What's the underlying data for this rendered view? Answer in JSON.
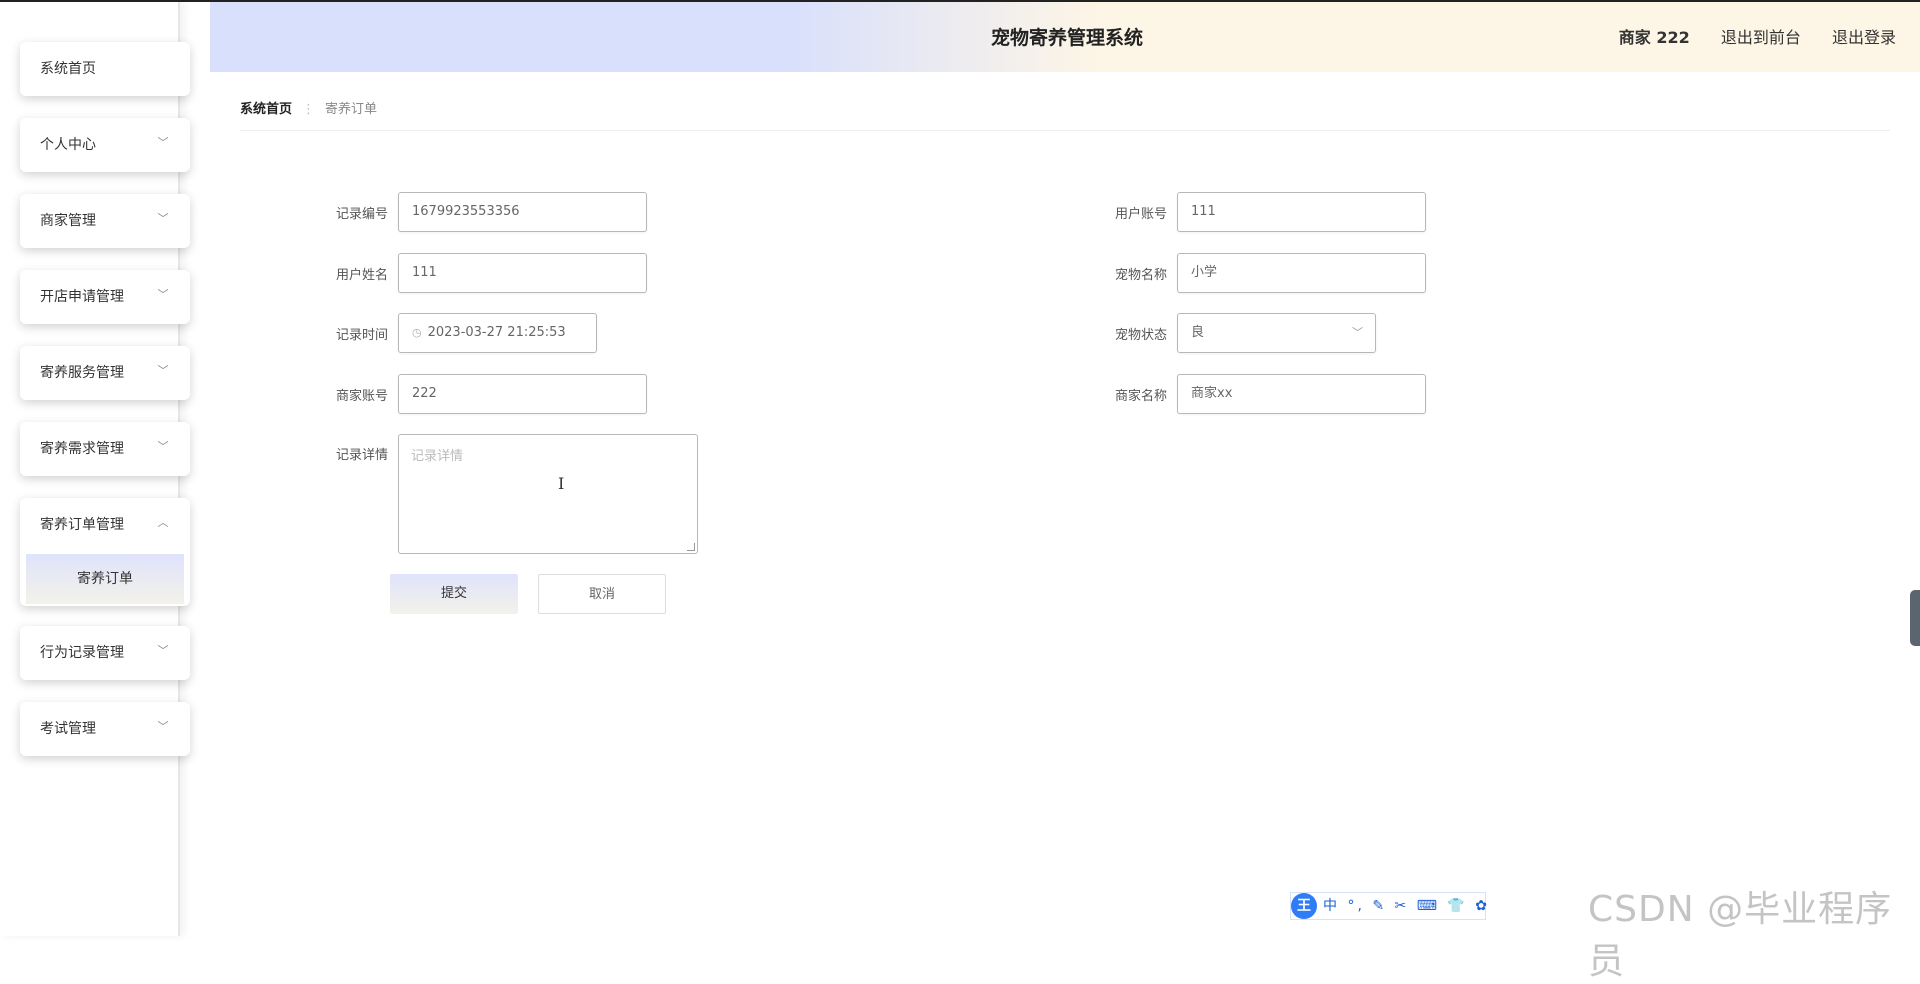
{
  "app_title": "宠物寄养管理系统",
  "header": {
    "merchant": "商家 222",
    "back_to_front": "退出到前台",
    "logout": "退出登录"
  },
  "sidebar": {
    "items": [
      {
        "label": "系统首页",
        "icon": "none"
      },
      {
        "label": "个人中心",
        "icon": "chevron-down"
      },
      {
        "label": "商家管理",
        "icon": "chevron-down"
      },
      {
        "label": "开店申请管理",
        "icon": "chevron-down"
      },
      {
        "label": "寄养服务管理",
        "icon": "chevron-down"
      },
      {
        "label": "寄养需求管理",
        "icon": "chevron-down"
      },
      {
        "label": "寄养订单管理",
        "icon": "chevron-up",
        "expanded": true,
        "children": [
          {
            "label": "寄养订单"
          }
        ]
      },
      {
        "label": "行为记录管理",
        "icon": "chevron-down"
      },
      {
        "label": "考试管理",
        "icon": "chevron-down"
      }
    ]
  },
  "breadcrumb": {
    "home": "系统首页",
    "separator": "⋮",
    "current": "寄养订单"
  },
  "form": {
    "record_no": {
      "label": "记录编号",
      "value": "1679923553356"
    },
    "user_account": {
      "label": "用户账号",
      "value": "111"
    },
    "user_name": {
      "label": "用户姓名",
      "value": "111"
    },
    "pet_name": {
      "label": "宠物名称",
      "value": "小学"
    },
    "record_time": {
      "label": "记录时间",
      "value": "2023-03-27 21:25:53"
    },
    "pet_status": {
      "label": "宠物状态",
      "value": "良"
    },
    "merchant_account": {
      "label": "商家账号",
      "value": "222"
    },
    "merchant_name": {
      "label": "商家名称",
      "value": "商家xx"
    },
    "record_detail": {
      "label": "记录详情",
      "placeholder": "记录详情"
    }
  },
  "buttons": {
    "submit": "提交",
    "cancel": "取消"
  },
  "ime_toolbar": {
    "badge": "王",
    "icons": "中 °, ✎ ✂ ⌨ 👕 ✿"
  },
  "watermark": "CSDN @毕业程序员",
  "colors": {
    "header_left": "#d9e0fb",
    "header_right": "#fdf5e6",
    "submit_gradient_top": "#dfe3fb",
    "submit_gradient_bottom": "#f3f2ea"
  }
}
